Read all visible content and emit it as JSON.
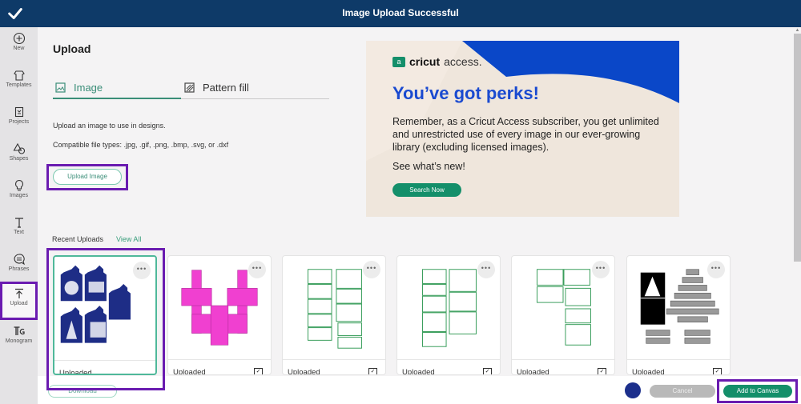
{
  "topbar": {
    "title": "Image Upload Successful",
    "icon": "checkmark-icon"
  },
  "sidebar": {
    "items": [
      {
        "label": "New",
        "icon": "plus-circle-icon"
      },
      {
        "label": "Templates",
        "icon": "shirt-icon"
      },
      {
        "label": "Projects",
        "icon": "clipboard-icon"
      },
      {
        "label": "Shapes",
        "icon": "shapes-icon"
      },
      {
        "label": "Images",
        "icon": "lightbulb-icon"
      },
      {
        "label": "Text",
        "icon": "text-icon"
      },
      {
        "label": "Phrases",
        "icon": "speech-bubble-icon"
      },
      {
        "label": "Upload",
        "icon": "upload-icon",
        "active": true
      },
      {
        "label": "Monogram",
        "icon": "monogram-icon"
      }
    ]
  },
  "panel": {
    "title": "Upload",
    "tabs": [
      {
        "label": "Image",
        "icon": "image-icon",
        "active": true
      },
      {
        "label": "Pattern fill",
        "icon": "pattern-icon",
        "active": false
      }
    ],
    "description": "Upload an image to use in designs.",
    "file_types": "Compatible file types: .jpg, .gif, .png, .bmp, .svg, or .dxf",
    "upload_button": "Upload Image"
  },
  "promo": {
    "brand_bold": "cricut",
    "brand_light": "access.",
    "brand_mark": "a",
    "headline": "You’ve got perks!",
    "body": "Remember, as a Cricut Access subscriber, you get unlimited and unrestricted use of every image in our ever-growing library (excluding licensed images).",
    "cta_text": "See what’s new!",
    "button": "Search Now",
    "colors": {
      "headline": "#1a4ad0",
      "button": "#148f6a"
    }
  },
  "recent": {
    "label": "Recent Uploads",
    "view_all": "View All",
    "tiles": [
      {
        "caption": "Uploaded",
        "thumb": "blue-gift-tags",
        "selected": true
      },
      {
        "caption": "Uploaded",
        "thumb": "pink-box-template",
        "checked": true
      },
      {
        "caption": "Uploaded",
        "thumb": "green-text-cards",
        "checked": true
      },
      {
        "caption": "Uploaded",
        "thumb": "green-text-cards",
        "checked": true
      },
      {
        "caption": "Uploaded",
        "thumb": "green-text-cards",
        "checked": true
      },
      {
        "caption": "Uploaded",
        "thumb": "tree-stack-pieces",
        "checked": true
      }
    ],
    "more_label": "•••",
    "check_glyph": "✓"
  },
  "footer": {
    "download": "Download",
    "cancel": "Cancel",
    "add_to_canvas": "Add to Canvas"
  }
}
